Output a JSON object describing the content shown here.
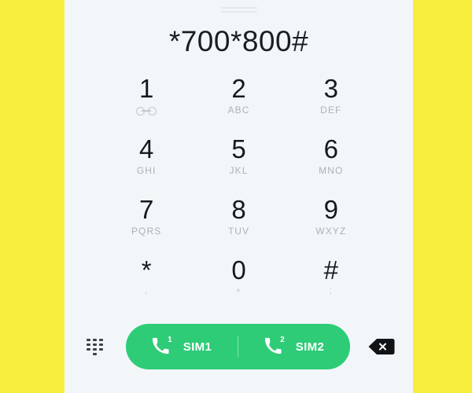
{
  "theme": {
    "letterbox_color": "#f7ee3d",
    "panel_background": "#f2f6f9",
    "call_button_color": "#2ecc77",
    "digit_color": "#16191c",
    "sublabel_color": "#a9b2bb"
  },
  "display": {
    "number": "*700*800#"
  },
  "keypad": [
    {
      "digit": "1",
      "sub": "",
      "icon": "voicemail-icon"
    },
    {
      "digit": "2",
      "sub": "ABC",
      "icon": ""
    },
    {
      "digit": "3",
      "sub": "DEF",
      "icon": ""
    },
    {
      "digit": "4",
      "sub": "GHI",
      "icon": ""
    },
    {
      "digit": "5",
      "sub": "JKL",
      "icon": ""
    },
    {
      "digit": "6",
      "sub": "MNO",
      "icon": ""
    },
    {
      "digit": "7",
      "sub": "PQRS",
      "icon": ""
    },
    {
      "digit": "8",
      "sub": "TUV",
      "icon": ""
    },
    {
      "digit": "9",
      "sub": "WXYZ",
      "icon": ""
    },
    {
      "digit": "*",
      "sub": ",",
      "icon": ""
    },
    {
      "digit": "0",
      "sub": "+",
      "icon": ""
    },
    {
      "digit": "#",
      "sub": ";",
      "icon": ""
    }
  ],
  "action_bar": {
    "keypad_toggle_icon": "dialpad-icon",
    "sim1": {
      "label": "SIM1",
      "badge": "1",
      "icon": "phone-handset-icon"
    },
    "sim2": {
      "label": "SIM2",
      "badge": "2",
      "icon": "phone-handset-icon"
    },
    "backspace_icon": "backspace-icon"
  }
}
